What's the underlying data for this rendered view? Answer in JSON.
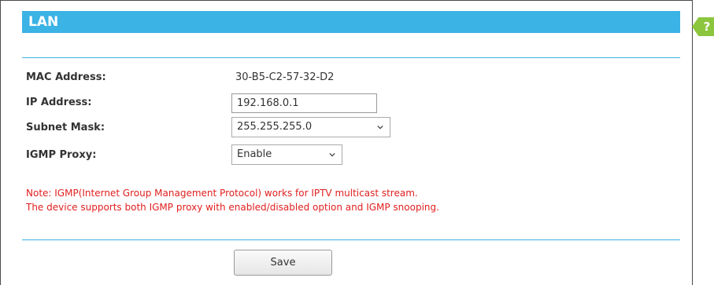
{
  "section": {
    "title": "LAN",
    "help_label": "?"
  },
  "form": {
    "mac_address": {
      "label": "MAC Address:",
      "value": "30-B5-C2-57-32-D2"
    },
    "ip_address": {
      "label": "IP Address:",
      "value": "192.168.0.1"
    },
    "subnet_mask": {
      "label": "Subnet Mask:",
      "selected": "255.255.255.0"
    },
    "igmp_proxy": {
      "label": "IGMP Proxy:",
      "selected": "Enable"
    }
  },
  "note": {
    "line1": "Note: IGMP(Internet Group Management Protocol) works for IPTV multicast stream.",
    "line2": "The device supports both IGMP proxy with enabled/disabled option and IGMP snooping."
  },
  "actions": {
    "save_label": "Save"
  },
  "colors": {
    "accent": "#3bb3e4",
    "help_tab": "#8cc63f",
    "note_text": "#e02020"
  },
  "icons": {
    "help": "help-tab-icon",
    "dropdown": "chevron-down-icon"
  }
}
